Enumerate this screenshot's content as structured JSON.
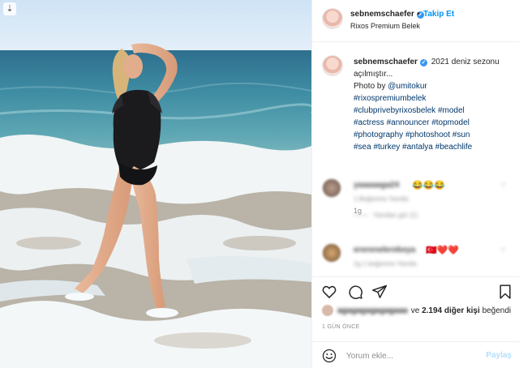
{
  "post": {
    "username": "sebnemschaefer",
    "follow_label": "Takip Et",
    "separator": "•",
    "location": "Rixos Premium Belek",
    "download_icon": "download-icon"
  },
  "caption": {
    "username": "sebnemschaefer",
    "text": "2021 deniz sezonu açılmıştır...",
    "photo_by_prefix": "Photo by",
    "photo_by_mention": "@umitokur",
    "hashtags": [
      "#rixospremiumbelek",
      "#clubprivebyrixosbelek",
      "#model",
      "#actress",
      "#announcer",
      "#topmodel",
      "#photography",
      "#photoshoot",
      "#sun",
      "#sea",
      "#turkey",
      "#antalya",
      "#beachlife"
    ],
    "time": "1g"
  },
  "comments": [
    {
      "name": "yaaaaaga24",
      "emoji": "😂😂😂",
      "meta": "1 Beğenme  Yanıtla",
      "replies": "Yanıtları gör (1)"
    },
    {
      "name": "ererenelerekeya",
      "emoji": "🇹🇷❤️❤️",
      "meta": "1g  1 beğenme  Yanıtla"
    }
  ],
  "likes": {
    "blurred_name": "agagagagagagaaa",
    "connector": "ve",
    "count_text": "2.194 diğer kişi",
    "suffix": "beğendi"
  },
  "post_date": "1 GÜN ÖNCE",
  "comment_box": {
    "placeholder": "Yorum ekle...",
    "post_label": "Paylaş"
  },
  "colors": {
    "link": "#00376b",
    "accent": "#0095f6",
    "muted": "#8e8e8e",
    "post_disabled": "#b2dffc"
  }
}
